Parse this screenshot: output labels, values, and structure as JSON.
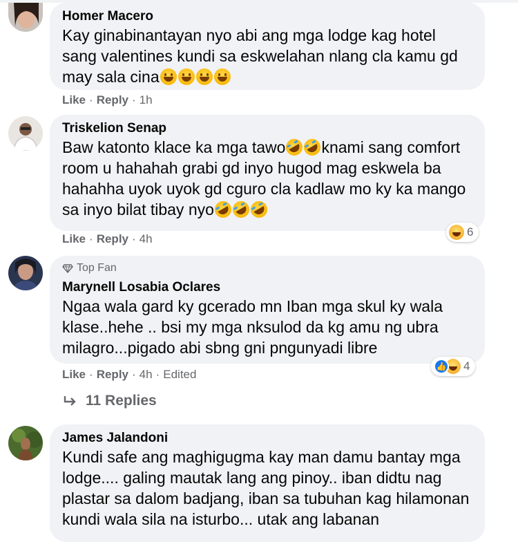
{
  "comments": [
    {
      "name": "Homer Macero",
      "text": "Kay ginabinantayan nyo abi ang mga lodge kag hotel sang valentines kundi sa eskwelahan nlang cla kamu gd may sala cina",
      "action_like": "Like",
      "action_reply": "Reply",
      "time": "1h",
      "emoji_trailing": [
        "grinning-face",
        "grinning-face",
        "grinning-face",
        "grinning-face"
      ]
    },
    {
      "name": "Triskelion Senap",
      "text_part1": "Baw katonto klace ka mga tawo",
      "text_part2": "knami sang comfort room u hahahah grabi gd inyo hugod mag eskwela ba hahahha uyok uyok gd cguro cla kadlaw mo ky ka mango sa inyo bilat tibay nyo",
      "action_like": "Like",
      "action_reply": "Reply",
      "time": "4h",
      "reactions": {
        "icons": [
          "haha-icon"
        ],
        "count": "6"
      }
    },
    {
      "badge": "Top Fan",
      "name": "Marynell Losabia Oclares",
      "text": "Ngaa wala gard ky gcerado mn Iban mga skul ky wala klase..hehe .. bsi my mga nksulod da kg amu ng ubra milagro...pigado abi sbng gni pngunyadi libre",
      "action_like": "Like",
      "action_reply": "Reply",
      "time": "4h",
      "edited": "Edited",
      "reactions": {
        "icons": [
          "like-icon",
          "haha-icon"
        ],
        "count": "4"
      }
    },
    {
      "name": "James Jalandoni",
      "text": "Kundi safe ang maghigugma kay man damu bantay mga lodge.... galing mautak lang ang pinoy.. iban didtu nag plastar sa dalom badjang, iban sa tubuhan kag hilamonan kundi wala sila na isturbo... utak ang labanan"
    }
  ],
  "replies_link": "11 Replies",
  "colors": {
    "bubble": "#f0f2f5",
    "secondary_text": "#65676b",
    "primary_text": "#050505",
    "like_blue": "#1877f2"
  }
}
